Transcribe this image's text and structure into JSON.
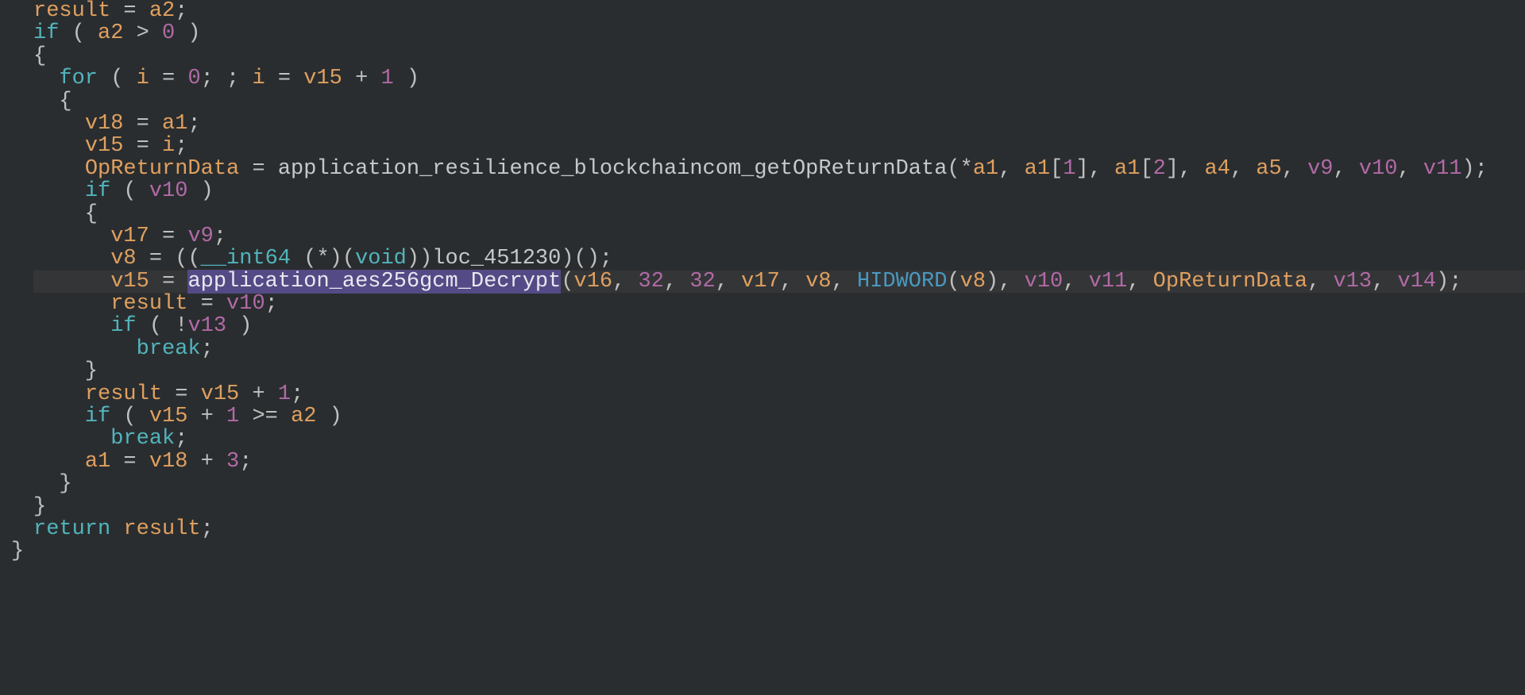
{
  "colors": {
    "background": "#2a2d2f",
    "text_default": "#c8c8c8",
    "variable": "#dfa060",
    "keyword": "#52b4bc",
    "literal": "#b16aa7",
    "function": "#c6c8ca",
    "selection_bg": "#544a86",
    "special_id": "#4999c2"
  },
  "editor": {
    "highlighted_line_index": 12,
    "selection_text": "application_aes256gcm_Decrypt"
  },
  "lines": [
    [
      {
        "cls": "tok-var",
        "t": "result"
      },
      {
        "cls": "tok-pun",
        "t": " = "
      },
      {
        "cls": "tok-var",
        "t": "a2"
      },
      {
        "cls": "tok-pun",
        "t": ";"
      }
    ],
    [
      {
        "cls": "tok-key",
        "t": "if"
      },
      {
        "cls": "tok-pun",
        "t": " ( "
      },
      {
        "cls": "tok-var",
        "t": "a2"
      },
      {
        "cls": "tok-pun",
        "t": " > "
      },
      {
        "cls": "tok-lit",
        "t": "0"
      },
      {
        "cls": "tok-pun",
        "t": " )"
      }
    ],
    [
      {
        "cls": "tok-pun",
        "t": "{"
      }
    ],
    [
      {
        "cls": "tok-pun",
        "t": "  "
      },
      {
        "cls": "tok-key",
        "t": "for"
      },
      {
        "cls": "tok-pun",
        "t": " ( "
      },
      {
        "cls": "tok-var",
        "t": "i"
      },
      {
        "cls": "tok-pun",
        "t": " = "
      },
      {
        "cls": "tok-lit",
        "t": "0"
      },
      {
        "cls": "tok-pun",
        "t": "; ; "
      },
      {
        "cls": "tok-var",
        "t": "i"
      },
      {
        "cls": "tok-pun",
        "t": " = "
      },
      {
        "cls": "tok-var",
        "t": "v15"
      },
      {
        "cls": "tok-pun",
        "t": " + "
      },
      {
        "cls": "tok-lit",
        "t": "1"
      },
      {
        "cls": "tok-pun",
        "t": " )"
      }
    ],
    [
      {
        "cls": "tok-pun",
        "t": "  {"
      }
    ],
    [
      {
        "cls": "tok-pun",
        "t": "    "
      },
      {
        "cls": "tok-var",
        "t": "v18"
      },
      {
        "cls": "tok-pun",
        "t": " = "
      },
      {
        "cls": "tok-var",
        "t": "a1"
      },
      {
        "cls": "tok-pun",
        "t": ";"
      }
    ],
    [
      {
        "cls": "tok-pun",
        "t": "    "
      },
      {
        "cls": "tok-var",
        "t": "v15"
      },
      {
        "cls": "tok-pun",
        "t": " = "
      },
      {
        "cls": "tok-var",
        "t": "i"
      },
      {
        "cls": "tok-pun",
        "t": ";"
      }
    ],
    [
      {
        "cls": "tok-pun",
        "t": "    "
      },
      {
        "cls": "tok-var",
        "t": "OpReturnData"
      },
      {
        "cls": "tok-pun",
        "t": " = "
      },
      {
        "cls": "tok-func",
        "t": "application_resilience_blockchaincom_getOpReturnData"
      },
      {
        "cls": "tok-pun",
        "t": "(*"
      },
      {
        "cls": "tok-var",
        "t": "a1"
      },
      {
        "cls": "tok-pun",
        "t": ", "
      },
      {
        "cls": "tok-var",
        "t": "a1"
      },
      {
        "cls": "tok-pun",
        "t": "["
      },
      {
        "cls": "tok-lit",
        "t": "1"
      },
      {
        "cls": "tok-pun",
        "t": "], "
      },
      {
        "cls": "tok-var",
        "t": "a1"
      },
      {
        "cls": "tok-pun",
        "t": "["
      },
      {
        "cls": "tok-lit",
        "t": "2"
      },
      {
        "cls": "tok-pun",
        "t": "], "
      },
      {
        "cls": "tok-var",
        "t": "a4"
      },
      {
        "cls": "tok-pun",
        "t": ", "
      },
      {
        "cls": "tok-var",
        "t": "a5"
      },
      {
        "cls": "tok-pun",
        "t": ", "
      },
      {
        "cls": "tok-lit",
        "t": "v9"
      },
      {
        "cls": "tok-pun",
        "t": ", "
      },
      {
        "cls": "tok-lit",
        "t": "v10"
      },
      {
        "cls": "tok-pun",
        "t": ", "
      },
      {
        "cls": "tok-lit",
        "t": "v11"
      },
      {
        "cls": "tok-pun",
        "t": ");"
      }
    ],
    [
      {
        "cls": "tok-pun",
        "t": "    "
      },
      {
        "cls": "tok-key",
        "t": "if"
      },
      {
        "cls": "tok-pun",
        "t": " ( "
      },
      {
        "cls": "tok-lit",
        "t": "v10"
      },
      {
        "cls": "tok-pun",
        "t": " )"
      }
    ],
    [
      {
        "cls": "tok-pun",
        "t": "    {"
      }
    ],
    [
      {
        "cls": "tok-pun",
        "t": "      "
      },
      {
        "cls": "tok-var",
        "t": "v17"
      },
      {
        "cls": "tok-pun",
        "t": " = "
      },
      {
        "cls": "tok-lit",
        "t": "v9"
      },
      {
        "cls": "tok-pun",
        "t": ";"
      }
    ],
    [
      {
        "cls": "tok-pun",
        "t": "      "
      },
      {
        "cls": "tok-var",
        "t": "v8"
      },
      {
        "cls": "tok-pun",
        "t": " = (("
      },
      {
        "cls": "tok-type",
        "t": "__int64"
      },
      {
        "cls": "tok-pun",
        "t": " (*)("
      },
      {
        "cls": "tok-type",
        "t": "void"
      },
      {
        "cls": "tok-pun",
        "t": "))"
      },
      {
        "cls": "tok-func",
        "t": "loc_451230"
      },
      {
        "cls": "tok-pun",
        "t": ")();"
      }
    ],
    [
      {
        "cls": "tok-pun",
        "t": "      "
      },
      {
        "cls": "tok-var",
        "t": "v15"
      },
      {
        "cls": "tok-pun",
        "t": " = "
      },
      {
        "cls": "tok-sel",
        "t": "application_aes256gcm_Decrypt"
      },
      {
        "cls": "tok-pun",
        "t": "("
      },
      {
        "cls": "tok-var",
        "t": "v16"
      },
      {
        "cls": "tok-pun",
        "t": ", "
      },
      {
        "cls": "tok-lit",
        "t": "32"
      },
      {
        "cls": "tok-pun",
        "t": ", "
      },
      {
        "cls": "tok-lit",
        "t": "32"
      },
      {
        "cls": "tok-pun",
        "t": ", "
      },
      {
        "cls": "tok-var",
        "t": "v17"
      },
      {
        "cls": "tok-pun",
        "t": ", "
      },
      {
        "cls": "tok-var",
        "t": "v8"
      },
      {
        "cls": "tok-pun",
        "t": ", "
      },
      {
        "cls": "tok-hiw",
        "t": "HIDWORD"
      },
      {
        "cls": "tok-pun",
        "t": "("
      },
      {
        "cls": "tok-var",
        "t": "v8"
      },
      {
        "cls": "tok-pun",
        "t": "), "
      },
      {
        "cls": "tok-lit",
        "t": "v10"
      },
      {
        "cls": "tok-pun",
        "t": ", "
      },
      {
        "cls": "tok-lit",
        "t": "v11"
      },
      {
        "cls": "tok-pun",
        "t": ", "
      },
      {
        "cls": "tok-var",
        "t": "OpReturnData"
      },
      {
        "cls": "tok-pun",
        "t": ", "
      },
      {
        "cls": "tok-lit",
        "t": "v13"
      },
      {
        "cls": "tok-pun",
        "t": ", "
      },
      {
        "cls": "tok-lit",
        "t": "v14"
      },
      {
        "cls": "tok-pun",
        "t": ");"
      }
    ],
    [
      {
        "cls": "tok-pun",
        "t": "      "
      },
      {
        "cls": "tok-var",
        "t": "result"
      },
      {
        "cls": "tok-pun",
        "t": " = "
      },
      {
        "cls": "tok-lit",
        "t": "v10"
      },
      {
        "cls": "tok-pun",
        "t": ";"
      }
    ],
    [
      {
        "cls": "tok-pun",
        "t": "      "
      },
      {
        "cls": "tok-key",
        "t": "if"
      },
      {
        "cls": "tok-pun",
        "t": " ( !"
      },
      {
        "cls": "tok-lit",
        "t": "v13"
      },
      {
        "cls": "tok-pun",
        "t": " )"
      }
    ],
    [
      {
        "cls": "tok-pun",
        "t": "        "
      },
      {
        "cls": "tok-key",
        "t": "break"
      },
      {
        "cls": "tok-pun",
        "t": ";"
      }
    ],
    [
      {
        "cls": "tok-pun",
        "t": "    }"
      }
    ],
    [
      {
        "cls": "tok-pun",
        "t": "    "
      },
      {
        "cls": "tok-var",
        "t": "result"
      },
      {
        "cls": "tok-pun",
        "t": " = "
      },
      {
        "cls": "tok-var",
        "t": "v15"
      },
      {
        "cls": "tok-pun",
        "t": " + "
      },
      {
        "cls": "tok-lit",
        "t": "1"
      },
      {
        "cls": "tok-pun",
        "t": ";"
      }
    ],
    [
      {
        "cls": "tok-pun",
        "t": "    "
      },
      {
        "cls": "tok-key",
        "t": "if"
      },
      {
        "cls": "tok-pun",
        "t": " ( "
      },
      {
        "cls": "tok-var",
        "t": "v15"
      },
      {
        "cls": "tok-pun",
        "t": " + "
      },
      {
        "cls": "tok-lit",
        "t": "1"
      },
      {
        "cls": "tok-pun",
        "t": " >= "
      },
      {
        "cls": "tok-var",
        "t": "a2"
      },
      {
        "cls": "tok-pun",
        "t": " )"
      }
    ],
    [
      {
        "cls": "tok-pun",
        "t": "      "
      },
      {
        "cls": "tok-key",
        "t": "break"
      },
      {
        "cls": "tok-pun",
        "t": ";"
      }
    ],
    [
      {
        "cls": "tok-pun",
        "t": "    "
      },
      {
        "cls": "tok-var",
        "t": "a1"
      },
      {
        "cls": "tok-pun",
        "t": " = "
      },
      {
        "cls": "tok-var",
        "t": "v18"
      },
      {
        "cls": "tok-pun",
        "t": " + "
      },
      {
        "cls": "tok-lit",
        "t": "3"
      },
      {
        "cls": "tok-pun",
        "t": ";"
      }
    ],
    [
      {
        "cls": "tok-pun",
        "t": "  }"
      }
    ],
    [
      {
        "cls": "tok-pun",
        "t": "}"
      }
    ],
    [
      {
        "cls": "tok-key",
        "t": "return"
      },
      {
        "cls": "tok-pun",
        "t": " "
      },
      {
        "cls": "tok-var",
        "t": "result"
      },
      {
        "cls": "tok-pun",
        "t": ";"
      }
    ],
    [
      {
        "cls": "tok-pun",
        "pre": "noindent",
        "t": "}"
      }
    ]
  ]
}
